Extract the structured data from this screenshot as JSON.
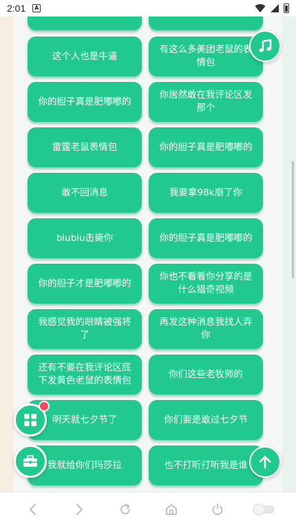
{
  "status": {
    "time": "2:01",
    "notif_glyph": "A"
  },
  "buttons": [
    [
      "",
      ""
    ],
    [
      "这个人也是牛逼",
      "有这么多美团老鼠的表情包"
    ],
    [
      "你的胆子真是肥嘟嘟的",
      "你居然敢在我评论区发那个"
    ],
    [
      "雷霆老鼠表情包",
      "你的胆子真是肥嘟嘟的"
    ],
    [
      "敢不回消息",
      "我要拿98k崩了你"
    ],
    [
      "biubiu击毙你",
      "你的胆子真是肥嘟嘟的"
    ],
    [
      "你的胆子才是肥嘟嘟的",
      "你也不看看你分享的是什么猎奇视频"
    ],
    [
      "我感觉我的眼睛被强将了",
      "再发这种消息我找人弄你"
    ],
    [
      "还有不要在我评论区底下发黄色老鼠的表情包",
      "你们这些老牧师的"
    ],
    [
      "明天就七夕节了",
      "你们要是敢过七夕节"
    ],
    [
      "我就给你们玛莎拉",
      "也不打听打听我是谁"
    ]
  ],
  "fabs": {
    "music": "music-note-icon",
    "apps": "apps-grid-icon",
    "toolbox": "toolbox-icon",
    "scroll_top": "arrow-up-icon"
  },
  "nav": [
    "back-icon",
    "forward-icon",
    "refresh-icon",
    "home-icon",
    "power-icon",
    "toggle-icon"
  ],
  "colors": {
    "accent": "#22c98f",
    "badge": "#f24a5a"
  }
}
